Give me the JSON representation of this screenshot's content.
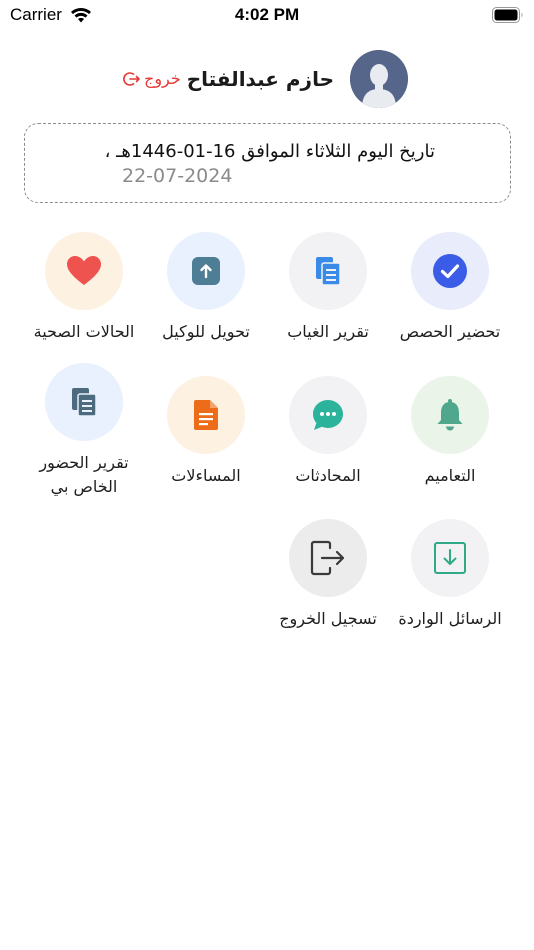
{
  "status_bar": {
    "carrier": "Carrier",
    "time": "4:02 PM"
  },
  "header": {
    "user_name": "حازم عبدالفتاح",
    "logout_label": "خروج"
  },
  "date_card": {
    "hijri_line": "تاريخ اليوم الثلاثاء الموافق 16-01-1446هـ ،",
    "gregorian_line": "22-07-2024"
  },
  "menu": {
    "items": [
      {
        "label": "تحضير الحصص",
        "icon": "check-circle-icon",
        "bg": "#e9ecfb",
        "color": "#3b5ce6"
      },
      {
        "label": "تقرير الغياب",
        "icon": "documents-icon",
        "bg": "#f2f2f4",
        "color": "#3a8ae8"
      },
      {
        "label": "تحويل للوكيل",
        "icon": "upload-icon",
        "bg": "#e8f1fd",
        "color": "#4e7d96"
      },
      {
        "label": "الحالات الصحية",
        "icon": "heart-icon",
        "bg": "#fdf1e1",
        "color": "#ef5350"
      },
      {
        "label": "التعاميم",
        "icon": "bell-icon",
        "bg": "#eaf4e8",
        "color": "#4fa88c"
      },
      {
        "label": "المحادثات",
        "icon": "chat-bubble-icon",
        "bg": "#f2f2f4",
        "color": "#2bb39b"
      },
      {
        "label": "المساءلات",
        "icon": "document-icon",
        "bg": "#fdf1e1",
        "color": "#ec6c19"
      },
      {
        "label": "تقرير الحضور الخاص بي",
        "icon": "documents-icon",
        "bg": "#e8f1fd",
        "color": "#4d6b7f"
      },
      {
        "label": "الرسائل الواردة",
        "icon": "inbox-download-icon",
        "bg": "#f2f2f4",
        "color": "#2fa987"
      },
      {
        "label": "تسجيل الخروج",
        "icon": "logout-icon",
        "bg": "#ececec",
        "color": "#3a3a3a"
      }
    ]
  }
}
